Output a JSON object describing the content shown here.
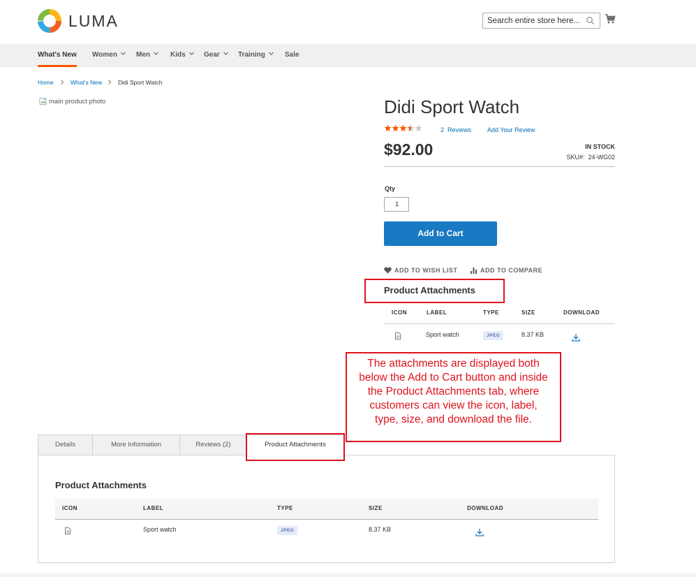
{
  "header": {
    "logo_text": "LUMA",
    "search_placeholder": "Search entire store here...",
    "icons": {
      "search": "search-icon",
      "cart": "cart-icon"
    }
  },
  "nav": {
    "items": [
      "What's New",
      "Women",
      "Men",
      "Kids",
      "Gear",
      "Training",
      "Sale"
    ],
    "active": "What's New",
    "accent_color": "#ff5501"
  },
  "breadcrumb": {
    "items": [
      "Home",
      "What's New",
      "Didi Sport Watch"
    ]
  },
  "gallery": {
    "main_photo_alt": "main product photo"
  },
  "product": {
    "name": "Didi Sport Watch",
    "rating_stars": 3.5,
    "reviews_count": "2",
    "reviews_label": "Reviews",
    "add_review": "Add Your Review",
    "price": "$92.00",
    "stock": "IN STOCK",
    "sku_label": "SKU#:",
    "sku": "24-WG02",
    "qty_label": "Qty",
    "qty_value": "1",
    "add_to_cart": "Add to Cart",
    "wish_list": "ADD TO WISH LIST",
    "compare": "ADD TO COMPARE",
    "button_color": "#1979c3"
  },
  "attachments": {
    "title": "Product Attachments",
    "columns": [
      "ICON",
      "LABEL",
      "TYPE",
      "SIZE",
      "DOWNLOAD"
    ],
    "rows": [
      {
        "label": "Sport watch",
        "type": "JPEG",
        "size": "8.37 KB"
      }
    ]
  },
  "callout": {
    "lines": [
      "The attachments are displayed both",
      "below the Add to Cart button and inside",
      "the Product Attachments tab, where",
      "customers can view the icon, label,",
      "type, size, and download the file."
    ],
    "color": "#e0131d"
  },
  "tabs": {
    "items": [
      "Details",
      "More Information",
      "Reviews (2)",
      "Product Attachments"
    ],
    "active": "Product Attachments"
  },
  "tab_panel": {
    "title": "Product Attachments",
    "columns": [
      "ICON",
      "LABEL",
      "TYPE",
      "SIZE",
      "DOWNLOAD"
    ],
    "rows": [
      {
        "label": "Sport watch",
        "type": "JPEG",
        "size": "8.37 KB"
      }
    ]
  }
}
